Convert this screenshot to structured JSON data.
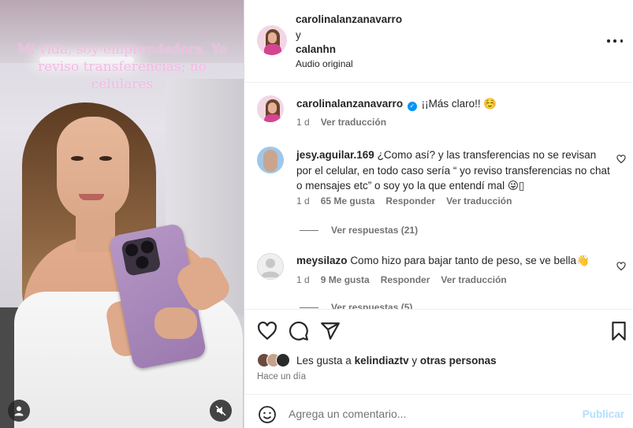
{
  "media": {
    "overlay_text": "Mi vida, soy emprendedora. Yo reviso transferencias; no celulares"
  },
  "header": {
    "user1": "carolinalanzanavarro",
    "joiner": "y",
    "user2": "calanhn",
    "audio": "Audio original"
  },
  "caption": {
    "user": "carolinalanzanavarro",
    "text": "¡¡Más claro!! ☺️",
    "time": "1 d",
    "translate": "Ver traducción"
  },
  "comments": [
    {
      "user": "jesy.aguilar.169",
      "text": "¿Como así? y las transferencias no se revisan por el celular, en todo caso sería “ yo reviso transferencias no chat o mensajes etc” o soy yo la que entendí mal 😜▯",
      "time": "1 d",
      "likes": "65 Me gusta",
      "reply": "Responder",
      "translate": "Ver traducción",
      "replies": "Ver respuestas (21)"
    },
    {
      "user": "meysilazo",
      "text": "Como hizo para bajar tanto de peso, se ve bella👋",
      "time": "1 d",
      "likes": "9 Me gusta",
      "reply": "Responder",
      "translate": "Ver traducción",
      "replies": "Ver respuestas (5)"
    }
  ],
  "likes": {
    "prefix": "Les gusta a",
    "user": "kelindiaztv",
    "middle": "y",
    "others": "otras personas"
  },
  "timestamp": "Hace un día",
  "add_comment": {
    "placeholder": "Agrega un comentario...",
    "publish": "Publicar"
  },
  "colors": {
    "overlay_text": "#f5b8e4",
    "publish_disabled": "#b2dffc",
    "verified": "#0095f6"
  }
}
